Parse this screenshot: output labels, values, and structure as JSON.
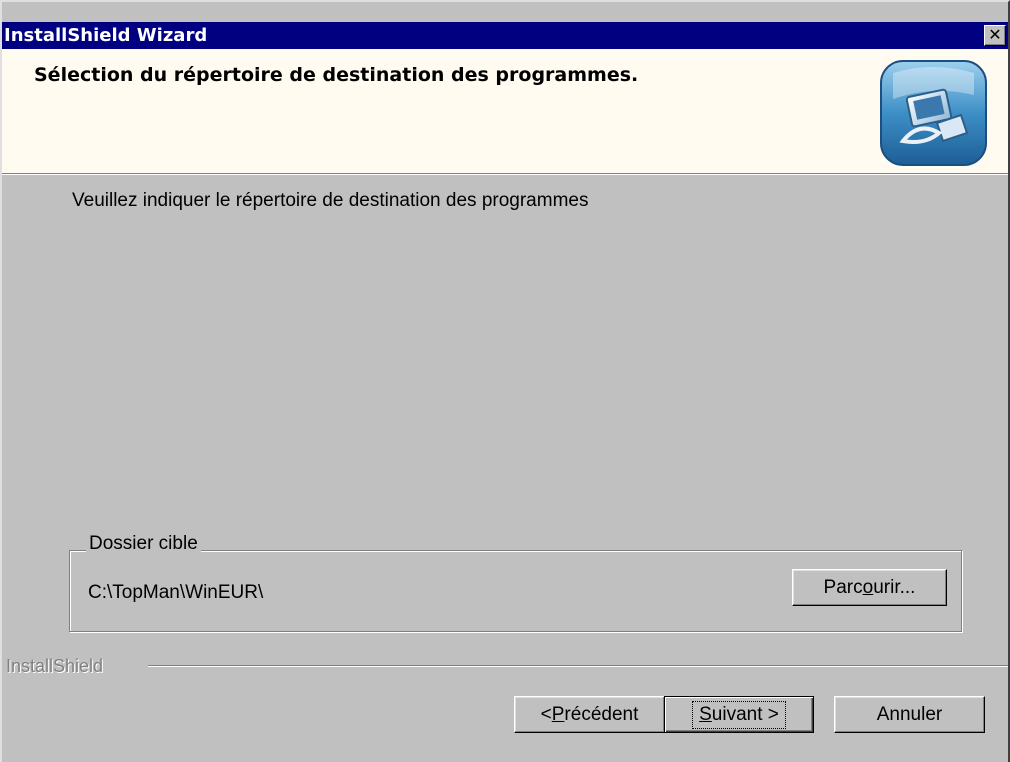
{
  "window": {
    "title": "InstallShield Wizard",
    "close_glyph": "✕"
  },
  "header": {
    "heading": "Sélection du répertoire de destination des programmes.",
    "logo_icon": "installshield-computer-icon"
  },
  "body": {
    "instruction": "Veuillez indiquer le répertoire de destination des programmes"
  },
  "destination": {
    "group_label": "Dossier cible",
    "path": "C:\\TopMan\\WinEUR\\",
    "browse_pre": "Parc",
    "browse_accel": "o",
    "browse_post": "urir..."
  },
  "footer": {
    "brand": "InstallShield",
    "back_pre": "< ",
    "back_accel": "P",
    "back_post": "récédent",
    "next_accel": "S",
    "next_post": "uivant >",
    "cancel_label": "Annuler"
  },
  "colors": {
    "titlebar": "#000080",
    "header_bg": "#fffbf0",
    "face": "#c0c0c0"
  }
}
